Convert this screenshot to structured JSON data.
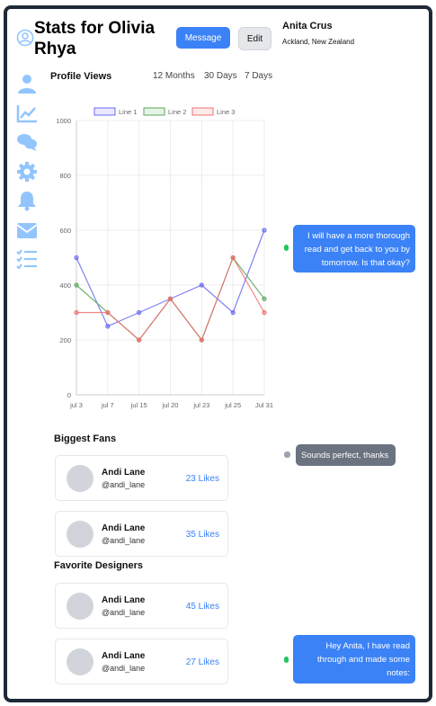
{
  "header": {
    "title": "Stats for Olivia Rhya",
    "message_button": "Message",
    "edit_button": "Edit"
  },
  "user": {
    "name": "Anita Crus",
    "location": "Ackland, New Zealand"
  },
  "sidebar": {
    "items": [
      {
        "icon": "user-icon"
      },
      {
        "icon": "chart-line-icon"
      },
      {
        "icon": "comments-icon"
      },
      {
        "icon": "gear-icon"
      },
      {
        "icon": "bell-icon"
      },
      {
        "icon": "envelope-icon"
      },
      {
        "icon": "tasks-icon"
      }
    ]
  },
  "profile_views": {
    "title": "Profile Views",
    "tabs": [
      "12 Months",
      "30 Days",
      "7 Days"
    ]
  },
  "chart_data": {
    "type": "line",
    "categories": [
      "jul 3",
      "jul 7",
      "jul 15",
      "jul 20",
      "jul 23",
      "jul 25",
      "Jul 31"
    ],
    "series": [
      {
        "name": "Line 1",
        "values": [
          500,
          250,
          300,
          350,
          400,
          300,
          600
        ],
        "color": "#6b6bf2"
      },
      {
        "name": "Line 2",
        "values": [
          400,
          300,
          200,
          350,
          200,
          500,
          350
        ],
        "color": "#5aa85a"
      },
      {
        "name": "Line 3",
        "values": [
          300,
          300,
          200,
          350,
          200,
          500,
          300
        ],
        "color": "#f07070"
      }
    ],
    "ylim": [
      0,
      1000
    ],
    "yticks": [
      0,
      200,
      400,
      600,
      800,
      1000
    ],
    "grid": true,
    "legend": "top"
  },
  "biggest_fans": {
    "title": "Biggest Fans",
    "items": [
      {
        "name": "Andi Lane",
        "handle": "@andi_lane",
        "likes": "23 Likes"
      },
      {
        "name": "Andi Lane",
        "handle": "@andi_lane",
        "likes": "35 Likes"
      }
    ]
  },
  "favorite_designers": {
    "title": "Favorite Designers",
    "items": [
      {
        "name": "Andi Lane",
        "handle": "@andi_lane",
        "likes": "45 Likes"
      },
      {
        "name": "Andi Lane",
        "handle": "@andi_lane",
        "likes": "27 Likes"
      }
    ]
  },
  "chat": {
    "messages": [
      {
        "text": "I will have a more thorough read and get back to you by tomorrow. Is that okay?",
        "status_color": "#22c55e"
      },
      {
        "text": "Sounds perfect, thanks",
        "status_color": "#9ca3af"
      },
      {
        "text": "Hey Anita, I have read through and made some notes:",
        "status_color": "#22c55e"
      }
    ]
  }
}
